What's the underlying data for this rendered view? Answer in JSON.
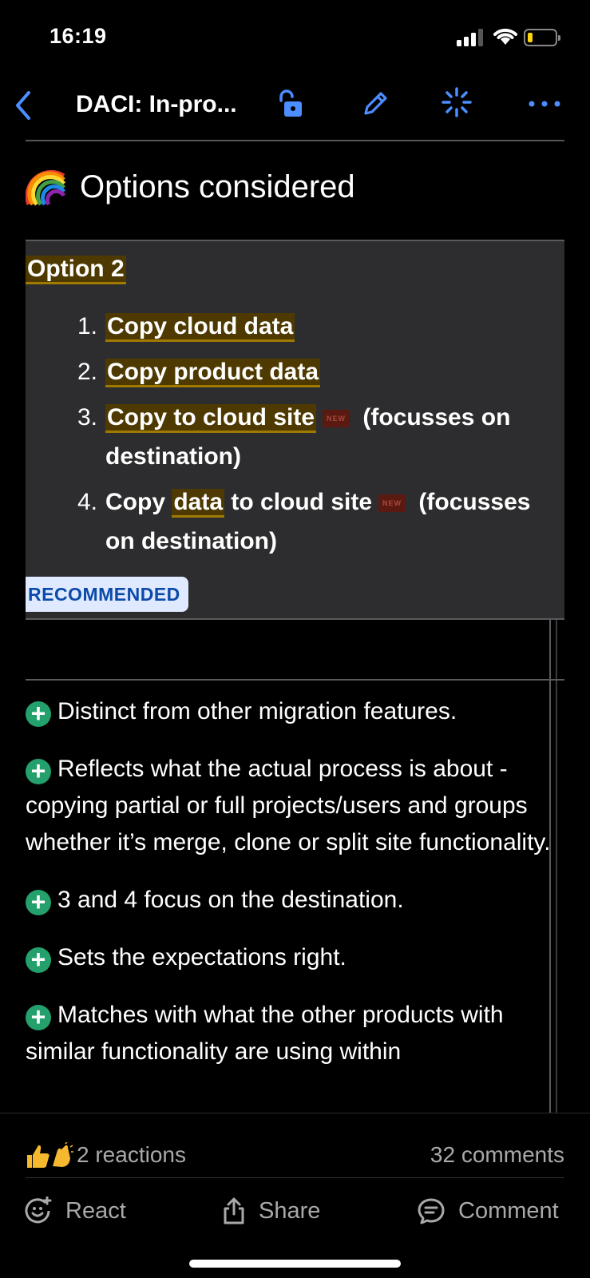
{
  "status_bar": {
    "time": "16:19",
    "battery_color": "#ffd60a"
  },
  "nav": {
    "title": "DACI: In-pro...",
    "accent_color": "#4c8dff",
    "icons": [
      "back-chevron-icon",
      "unlock-icon",
      "pencil-icon",
      "loading-spinner-icon",
      "more-icon"
    ]
  },
  "section": {
    "emoji": "rainbow-icon",
    "title": "Options considered"
  },
  "option": {
    "title": "Option 2",
    "items": [
      {
        "num": "1.",
        "highlight": "Copy cloud data",
        "rest": "",
        "new": false,
        "note": ""
      },
      {
        "num": "2.",
        "highlight": "Copy product data",
        "rest": "",
        "new": false,
        "note": ""
      },
      {
        "num": "3.",
        "highlight": "Copy to cloud site",
        "rest": "",
        "new": true,
        "note": "(focusses on destination)"
      },
      {
        "num": "4.",
        "pre": "Copy ",
        "highlight": "data",
        "rest": " to cloud site",
        "new": true,
        "note": "(focusses on destination)"
      }
    ],
    "new_label": "NEW",
    "badge": "RECOMMENDED",
    "highlight_color": "#4e3a00"
  },
  "pros": [
    "Distinct from other migration features.",
    "Reflects what the actual process is about - copying partial or full projects/users and groups whether it’s merge, clone or split site functionality.",
    "3 and 4 focus on the destination.",
    "Sets the expectations right.",
    "Matches with what the other products with similar functionality are using within"
  ],
  "plus_color": "#23a06c",
  "footer": {
    "reactions": "2 reactions",
    "comments": "32 comments",
    "react_label": "React",
    "share_label": "Share",
    "comment_label": "Comment"
  }
}
